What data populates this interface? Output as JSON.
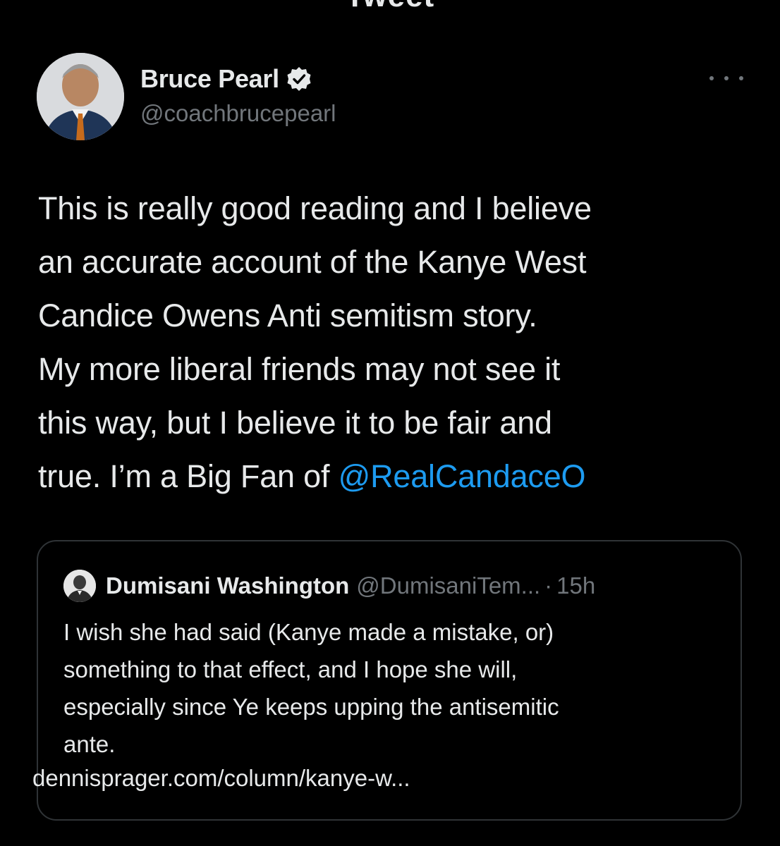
{
  "header": {
    "title": "Tweet"
  },
  "tweet": {
    "author": {
      "name": "Bruce Pearl",
      "handle": "@coachbrucepearl",
      "verified": true,
      "avatar_icon": "profile-photo"
    },
    "more_icon": "more-dots-icon",
    "text_lines": [
      "This is really good reading and I believe",
      "an accurate account of the Kanye West",
      "Candice Owens Anti semitism story.",
      "My more liberal friends may not see it",
      "this way, but I believe it to be fair and"
    ],
    "last_line_prefix": "true. I’m a Big Fan of ",
    "mention": "@RealCandaceO"
  },
  "quote": {
    "author_name": "Dumisani Washington",
    "author_handle": "@DumisaniTem...",
    "separator": "·",
    "time": "15h",
    "text_lines": [
      "I wish she had said (Kanye made a mistake, or)",
      "something to that effect, and I hope she will,",
      "especially since Ye keeps upping the antisemitic",
      "ante."
    ],
    "link": "dennisprager.com/column/kanye-w..."
  },
  "colors": {
    "background": "#000000",
    "text": "#e7e9ea",
    "secondary": "#71767b",
    "accent": "#1d9bf0",
    "border": "#2f3336"
  }
}
